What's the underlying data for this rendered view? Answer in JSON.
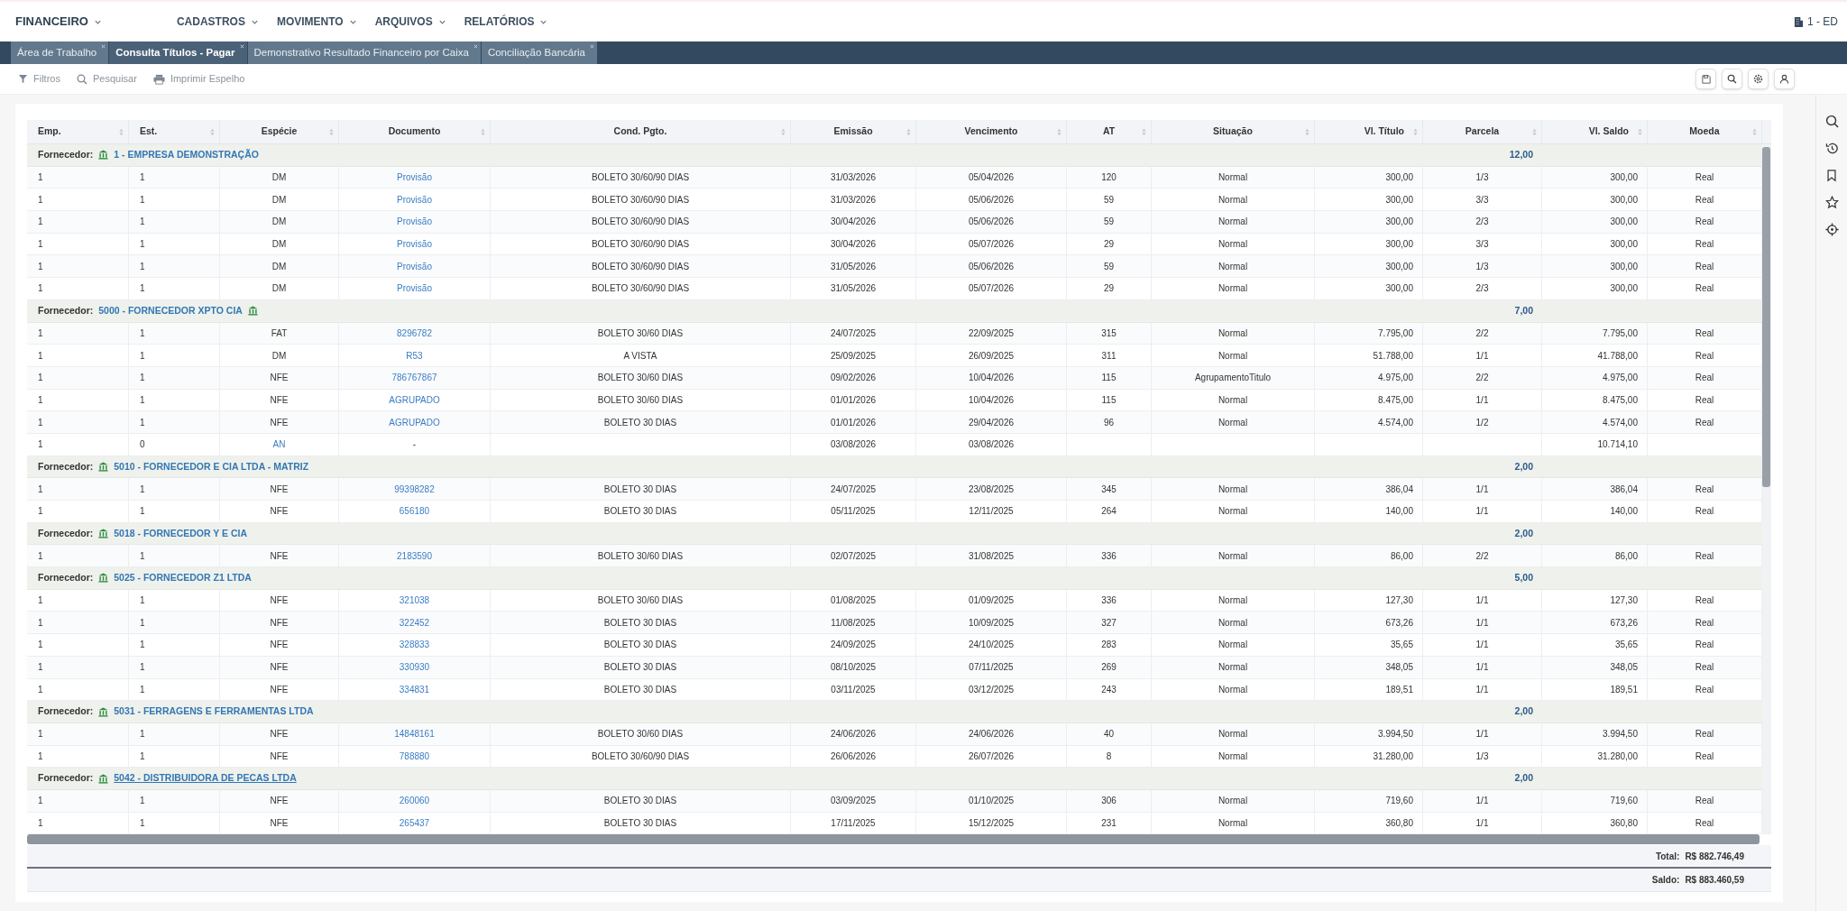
{
  "app": {
    "module": "FINANCEIRO",
    "menus": [
      "CADASTROS",
      "MOVIMENTO",
      "ARQUIVOS",
      "RELATÓRIOS"
    ],
    "company": "1 - ED"
  },
  "tabs": [
    {
      "label": "Área de Trabalho",
      "selected": false
    },
    {
      "label": "Consulta Títulos - Pagar",
      "selected": true
    },
    {
      "label": "Demonstrativo Resultado Financeiro por Caixa",
      "selected": false
    },
    {
      "label": "Conciliação Bancária",
      "selected": false
    }
  ],
  "toolbar": [
    {
      "kind": "filter",
      "label": "Filtros"
    },
    {
      "kind": "search",
      "label": "Pesquisar"
    },
    {
      "kind": "print",
      "label": "Imprimir Espelho"
    }
  ],
  "table": {
    "columns": [
      "Emp.",
      "Est.",
      "Espécie",
      "Documento",
      "Cond. Pgto.",
      "Emissão",
      "Vencimento",
      "AT",
      "Situação",
      "Vl. Título",
      "Parcela",
      "Vl. Saldo",
      "Moeda"
    ],
    "groups": [
      {
        "label": "Fornecedor:",
        "name": "1 - EMPRESA DEMONSTRAÇÃO",
        "kind": "icon_first",
        "underlined": false,
        "parcela_total": "12,00",
        "rows": [
          [
            "1",
            "1",
            "DM",
            "Provisão",
            "BOLETO 30/60/90 DIAS",
            "31/03/2026",
            "05/04/2026",
            "120",
            "Normal",
            "300,00",
            "1/3",
            "300,00",
            "Real"
          ],
          [
            "1",
            "1",
            "DM",
            "Provisão",
            "BOLETO 30/60/90 DIAS",
            "31/03/2026",
            "05/06/2026",
            "59",
            "Normal",
            "300,00",
            "3/3",
            "300,00",
            "Real"
          ],
          [
            "1",
            "1",
            "DM",
            "Provisão",
            "BOLETO 30/60/90 DIAS",
            "30/04/2026",
            "05/06/2026",
            "59",
            "Normal",
            "300,00",
            "2/3",
            "300,00",
            "Real"
          ],
          [
            "1",
            "1",
            "DM",
            "Provisão",
            "BOLETO 30/60/90 DIAS",
            "30/04/2026",
            "05/07/2026",
            "29",
            "Normal",
            "300,00",
            "3/3",
            "300,00",
            "Real"
          ],
          [
            "1",
            "1",
            "DM",
            "Provisão",
            "BOLETO 30/60/90 DIAS",
            "31/05/2026",
            "05/06/2026",
            "59",
            "Normal",
            "300,00",
            "1/3",
            "300,00",
            "Real"
          ],
          [
            "1",
            "1",
            "DM",
            "Provisão",
            "BOLETO 30/60/90 DIAS",
            "31/05/2026",
            "05/07/2026",
            "29",
            "Normal",
            "300,00",
            "2/3",
            "300,00",
            "Real"
          ]
        ]
      },
      {
        "label": "Fornecedor:",
        "name": "5000 - FORNECEDOR XPTO CIA",
        "kind": "name_first",
        "underlined": false,
        "parcela_total": "7,00",
        "rows": [
          [
            "1",
            "1",
            "FAT",
            "8296782",
            "BOLETO 30/60 DIAS",
            "24/07/2025",
            "22/09/2025",
            "315",
            "Normal",
            "7.795,00",
            "2/2",
            "7.795,00",
            "Real"
          ],
          [
            "1",
            "1",
            "DM",
            "R53",
            "A VISTA",
            "25/09/2025",
            "26/09/2025",
            "311",
            "Normal",
            "51.788,00",
            "1/1",
            "41.788,00",
            "Real"
          ],
          [
            "1",
            "1",
            "NFE",
            "786767867",
            "BOLETO 30/60 DIAS",
            "09/02/2026",
            "10/04/2026",
            "115",
            "AgrupamentoTitulo",
            "4.975,00",
            "2/2",
            "4.975,00",
            "Real"
          ],
          [
            "1",
            "1",
            "NFE",
            "AGRUPADO",
            "BOLETO 30/60 DIAS",
            "01/01/2026",
            "10/04/2026",
            "115",
            "Normal",
            "8.475,00",
            "1/1",
            "8.475,00",
            "Real"
          ],
          [
            "1",
            "1",
            "NFE",
            "AGRUPADO",
            "BOLETO 30 DIAS",
            "01/01/2026",
            "29/04/2026",
            "96",
            "Normal",
            "4.574,00",
            "1/2",
            "4.574,00",
            "Real"
          ],
          [
            "1",
            "0",
            "AN",
            "-",
            null,
            "03/08/2026",
            "03/08/2026",
            null,
            null,
            null,
            null,
            "10.714,10",
            null
          ]
        ]
      },
      {
        "label": "Fornecedor:",
        "name": "5010 - FORNECEDOR E CIA LTDA - MATRIZ",
        "kind": "icon_first",
        "underlined": false,
        "parcela_total": "2,00",
        "rows": [
          [
            "1",
            "1",
            "NFE",
            "99398282",
            "BOLETO 30 DIAS",
            "24/07/2025",
            "23/08/2025",
            "345",
            "Normal",
            "386,04",
            "1/1",
            "386,04",
            "Real"
          ],
          [
            "1",
            "1",
            "NFE",
            "656180",
            "BOLETO 30 DIAS",
            "05/11/2025",
            "12/11/2025",
            "264",
            "Normal",
            "140,00",
            "1/1",
            "140,00",
            "Real"
          ]
        ]
      },
      {
        "label": "Fornecedor:",
        "name": "5018 - FORNECEDOR Y E CIA",
        "kind": "icon_first",
        "underlined": false,
        "parcela_total": "2,00",
        "rows": [
          [
            "1",
            "1",
            "NFE",
            "2183590",
            "BOLETO 30/60 DIAS",
            "02/07/2025",
            "31/08/2025",
            "336",
            "Normal",
            "86,00",
            "2/2",
            "86,00",
            "Real"
          ]
        ]
      },
      {
        "label": "Fornecedor:",
        "name": "5025 - FORNECEDOR Z1 LTDA",
        "kind": "icon_first",
        "underlined": false,
        "parcela_total": "5,00",
        "rows": [
          [
            "1",
            "1",
            "NFE",
            "321038",
            "BOLETO 30/60 DIAS",
            "01/08/2025",
            "01/09/2025",
            "336",
            "Normal",
            "127,30",
            "1/1",
            "127,30",
            "Real"
          ],
          [
            "1",
            "1",
            "NFE",
            "322452",
            "BOLETO 30 DIAS",
            "11/08/2025",
            "10/09/2025",
            "327",
            "Normal",
            "673,26",
            "1/1",
            "673,26",
            "Real"
          ],
          [
            "1",
            "1",
            "NFE",
            "328833",
            "BOLETO 30 DIAS",
            "24/09/2025",
            "24/10/2025",
            "283",
            "Normal",
            "35,65",
            "1/1",
            "35,65",
            "Real"
          ],
          [
            "1",
            "1",
            "NFE",
            "330930",
            "BOLETO 30 DIAS",
            "08/10/2025",
            "07/11/2025",
            "269",
            "Normal",
            "348,05",
            "1/1",
            "348,05",
            "Real"
          ],
          [
            "1",
            "1",
            "NFE",
            "334831",
            "BOLETO 30 DIAS",
            "03/11/2025",
            "03/12/2025",
            "243",
            "Normal",
            "189,51",
            "1/1",
            "189,51",
            "Real"
          ]
        ]
      },
      {
        "label": "Fornecedor:",
        "name": "5031 - FERRAGENS E FERRAMENTAS LTDA",
        "kind": "icon_first",
        "underlined": false,
        "parcela_total": "2,00",
        "rows": [
          [
            "1",
            "1",
            "NFE",
            "14848161",
            "BOLETO 30/60 DIAS",
            "24/06/2026",
            "24/06/2026",
            "40",
            "Normal",
            "3.994,50",
            "1/1",
            "3.994,50",
            "Real"
          ],
          [
            "1",
            "1",
            "NFE",
            "788880",
            "BOLETO 30/60/90 DIAS",
            "26/06/2026",
            "26/07/2026",
            "8",
            "Normal",
            "31.280,00",
            "1/3",
            "31.280,00",
            "Real"
          ]
        ]
      },
      {
        "label": "Fornecedor:",
        "name": "5042 - DISTRIBUIDORA DE PECAS LTDA",
        "kind": "icon_first",
        "underlined": true,
        "parcela_total": "2,00",
        "rows": [
          [
            "1",
            "1",
            "NFE",
            "260060",
            "BOLETO 30 DIAS",
            "03/09/2025",
            "01/10/2025",
            "306",
            "Normal",
            "719,60",
            "1/1",
            "719,60",
            "Real"
          ],
          [
            "1",
            "1",
            "NFE",
            "265437",
            "BOLETO 30 DIAS",
            "17/11/2025",
            "15/12/2025",
            "231",
            "Normal",
            "360,80",
            "1/1",
            "360,80",
            "Real"
          ]
        ]
      }
    ]
  },
  "totals": [
    {
      "label": "Total:",
      "value": "R$ 882.746,49"
    },
    {
      "label": "Saldo:",
      "value": "R$ 883.460,59"
    }
  ]
}
